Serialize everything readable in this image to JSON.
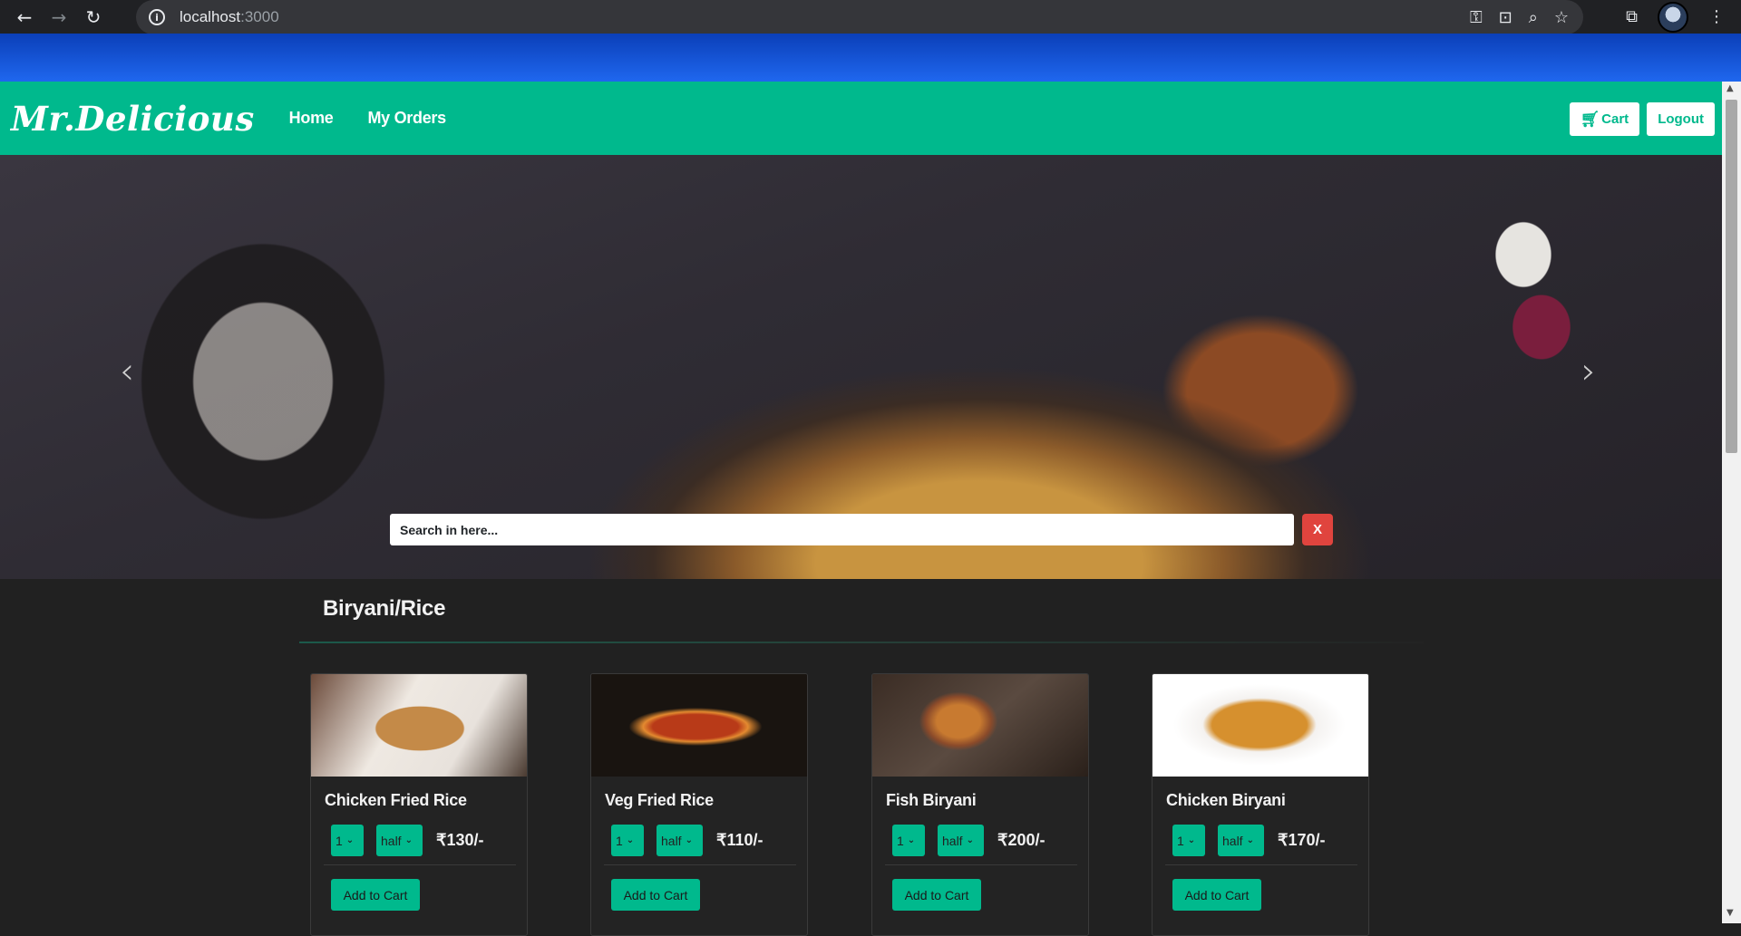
{
  "browser": {
    "back_icon": "←",
    "forward_icon": "→",
    "reload_icon": "↻",
    "url_host": "localhost",
    "url_port": ":3000",
    "icons": [
      "key-icon",
      "install-icon",
      "zoom-icon",
      "star-icon",
      "extensions-icon",
      "menu-icon"
    ]
  },
  "navbar": {
    "brand": "Mr.Delicious",
    "links": [
      "Home",
      "My Orders"
    ],
    "cart_label": "Cart",
    "logout_label": "Logout",
    "accent": "#00b98d"
  },
  "hero": {
    "prev_icon": "‹",
    "next_icon": "›",
    "search_placeholder": "Search in here...",
    "clear_label": "X",
    "clear_color": "#e0443e"
  },
  "category": {
    "title": "Biryani/Rice"
  },
  "items": [
    {
      "name": "Chicken Fried Rice",
      "qty": "1",
      "size": "half",
      "price": "₹130/-",
      "button": "Add to Cart"
    },
    {
      "name": "Veg Fried Rice",
      "qty": "1",
      "size": "half",
      "price": "₹110/-",
      "button": "Add to Cart"
    },
    {
      "name": "Fish Biryani",
      "qty": "1",
      "size": "half",
      "price": "₹200/-",
      "button": "Add to Cart"
    },
    {
      "name": "Chicken Biryani",
      "qty": "1",
      "size": "half",
      "price": "₹170/-",
      "button": "Add to Cart"
    }
  ]
}
